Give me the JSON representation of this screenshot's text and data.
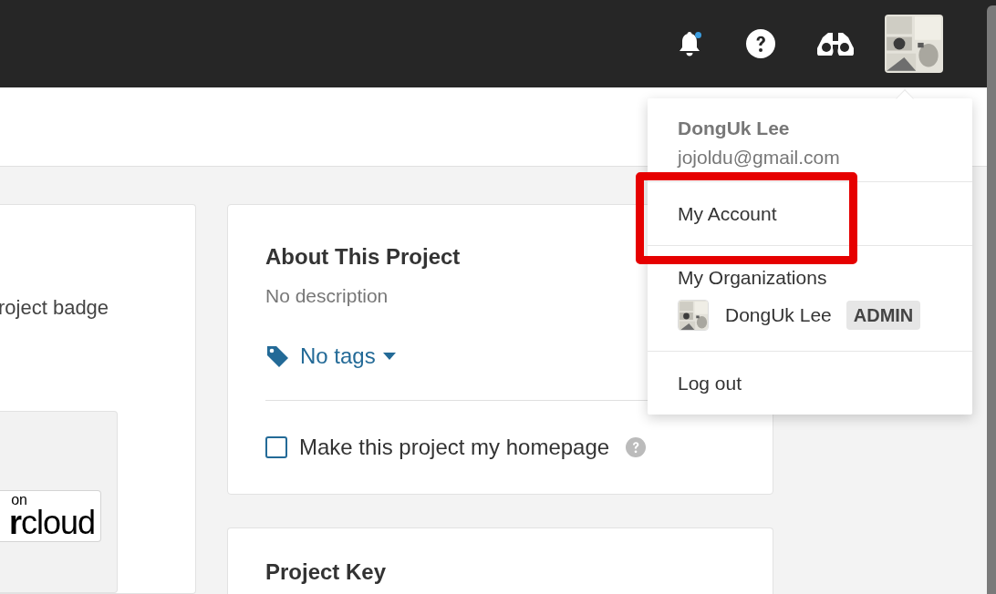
{
  "top_bar": {
    "notification_unread": true
  },
  "left_card": {
    "text": "roject badge",
    "badge": {
      "superscript": "on",
      "text": "**r**cloud"
    }
  },
  "about_card": {
    "title": "About This Project",
    "description": "No description",
    "tags_label": "No tags",
    "homepage_checkbox": {
      "label": "Make this project my homepage",
      "checked": false
    }
  },
  "key_card": {
    "title": "Project Key"
  },
  "account_menu": {
    "name": "DongUk Lee",
    "email": "jojoldu@gmail.com",
    "items": [
      {
        "kind": "link",
        "label": "My Account",
        "highlighted": true
      },
      {
        "kind": "section",
        "label": "My Organizations",
        "orgs": [
          {
            "name": "DongUk Lee",
            "role": "ADMIN"
          }
        ]
      },
      {
        "kind": "link",
        "label": "Log out",
        "highlighted": false
      }
    ]
  }
}
